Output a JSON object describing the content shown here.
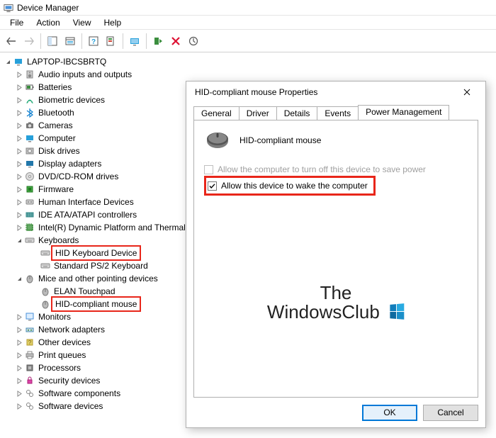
{
  "app": {
    "title": "Device Manager",
    "menus": [
      "File",
      "Action",
      "View",
      "Help"
    ]
  },
  "tree": {
    "root": "LAPTOP-IBCSBRTQ",
    "categories": [
      {
        "label": "Audio inputs and outputs",
        "icon": "speaker",
        "expanded": false
      },
      {
        "label": "Batteries",
        "icon": "battery",
        "expanded": false
      },
      {
        "label": "Biometric devices",
        "icon": "fingerprint",
        "expanded": false
      },
      {
        "label": "Bluetooth",
        "icon": "bluetooth",
        "expanded": false
      },
      {
        "label": "Cameras",
        "icon": "camera",
        "expanded": false
      },
      {
        "label": "Computer",
        "icon": "computer",
        "expanded": false
      },
      {
        "label": "Disk drives",
        "icon": "disk",
        "expanded": false
      },
      {
        "label": "Display adapters",
        "icon": "display",
        "expanded": false
      },
      {
        "label": "DVD/CD-ROM drives",
        "icon": "dvd",
        "expanded": false
      },
      {
        "label": "Firmware",
        "icon": "firmware",
        "expanded": false
      },
      {
        "label": "Human Interface Devices",
        "icon": "hid",
        "expanded": false
      },
      {
        "label": "IDE ATA/ATAPI controllers",
        "icon": "ide",
        "expanded": false
      },
      {
        "label": "Intel(R) Dynamic Platform and Thermal Framework",
        "icon": "intel",
        "expanded": false
      },
      {
        "label": "Keyboards",
        "icon": "keyboard",
        "expanded": true,
        "children": [
          {
            "label": "HID Keyboard Device",
            "icon": "keyboard",
            "highlight": true
          },
          {
            "label": "Standard PS/2 Keyboard",
            "icon": "keyboard"
          }
        ]
      },
      {
        "label": "Mice and other pointing devices",
        "icon": "mouse",
        "expanded": true,
        "children": [
          {
            "label": "ELAN Touchpad",
            "icon": "mouse"
          },
          {
            "label": "HID-compliant mouse",
            "icon": "mouse",
            "highlight": true
          }
        ]
      },
      {
        "label": "Monitors",
        "icon": "monitor",
        "expanded": false
      },
      {
        "label": "Network adapters",
        "icon": "network",
        "expanded": false
      },
      {
        "label": "Other devices",
        "icon": "other",
        "expanded": false
      },
      {
        "label": "Print queues",
        "icon": "print",
        "expanded": false
      },
      {
        "label": "Processors",
        "icon": "cpu",
        "expanded": false
      },
      {
        "label": "Security devices",
        "icon": "security",
        "expanded": false
      },
      {
        "label": "Software components",
        "icon": "software",
        "expanded": false
      },
      {
        "label": "Software devices",
        "icon": "software",
        "expanded": false
      }
    ]
  },
  "dialog": {
    "title": "HID-compliant mouse Properties",
    "tabs": [
      "General",
      "Driver",
      "Details",
      "Events",
      "Power Management"
    ],
    "active_tab": 4,
    "device_name": "HID-compliant mouse",
    "opt1_label": "Allow the computer to turn off this device to save power",
    "opt1_enabled": false,
    "opt1_checked": false,
    "opt2_label": "Allow this device to wake the computer",
    "opt2_checked": true,
    "ok_label": "OK",
    "cancel_label": "Cancel"
  },
  "watermark": {
    "line1": "The",
    "line2": "WindowsClub"
  }
}
